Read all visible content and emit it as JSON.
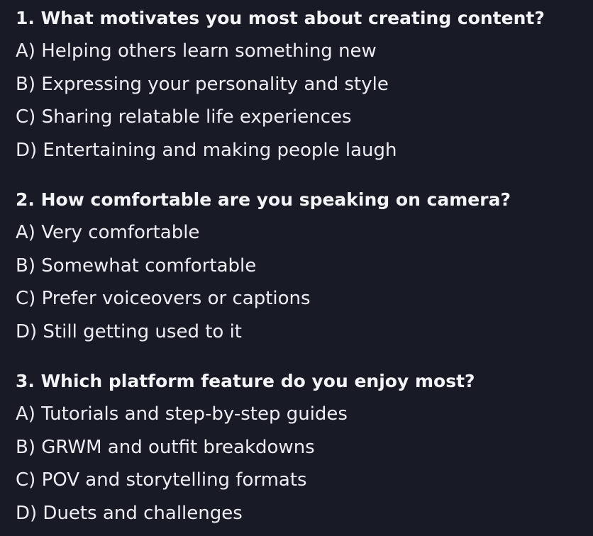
{
  "questions": [
    {
      "title": "1. What motivates you most about creating content?",
      "options": [
        "A) Helping others learn something new",
        "B) Expressing your personality and style",
        "C) Sharing relatable life experiences",
        "D) Entertaining and making people laugh"
      ]
    },
    {
      "title": "2. How comfortable are you speaking on camera?",
      "options": [
        "A) Very comfortable",
        "B) Somewhat comfortable",
        "C) Prefer voiceovers or captions",
        "D) Still getting used to it"
      ]
    },
    {
      "title": "3. Which platform feature do you enjoy most?",
      "options": [
        "A) Tutorials and step-by-step guides",
        "B) GRWM and outfit breakdowns",
        "C) POV and storytelling formats",
        "D) Duets and challenges"
      ]
    }
  ],
  "colors": {
    "background": "#181b25",
    "text": "#eef0f4"
  }
}
